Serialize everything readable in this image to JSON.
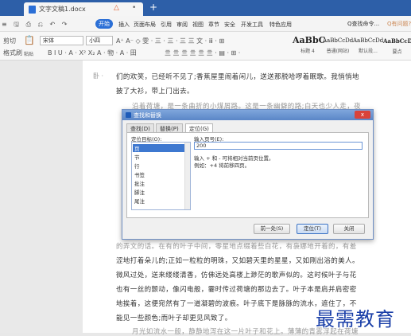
{
  "window": {
    "tab_title": "文字文稿1.docx",
    "tab_warning": "△",
    "tab_close": "•",
    "new_tab": "+"
  },
  "menu": {
    "quick_access": "≡ 🖫 ⎙ ⎌ ↶ ↷",
    "items": [
      "开始",
      "插入",
      "页面布局",
      "引用",
      "审阅",
      "视图",
      "章节",
      "安全",
      "开发工具",
      "特色应用"
    ],
    "active_index": 0,
    "search": "Q查找命令...",
    "help": "Q有问题?"
  },
  "toolbar": {
    "paste": "粘贴",
    "cut": "剪切",
    "format_painter": "格式刷",
    "font": "宋体",
    "size": "小四",
    "format_row": "B I U · A · X² X₂ A · 物 · A · 田",
    "para_row1": "A⁺ A⁻ ◇ 雯 · 三 · 三 · 三 三 文 · ⅲ · ⊞",
    "para_row2": "亖 亖 亖 亖 亖 亖 · ▤ · ⊞ ·",
    "styles": [
      {
        "sample": "AaBbC",
        "caption": "标题 4"
      },
      {
        "sample": "AaBbCcDd",
        "caption": "普通(网站)"
      },
      {
        "sample": "AaBbCcDd",
        "caption": "默认段..."
      },
      {
        "sample": "AaBbCcDc",
        "caption": "要点"
      }
    ]
  },
  "document": {
    "para_marker": "卧 ·",
    "lines": [
      "们的欢笑，已经听不见了;香蕉屋里闹着闲儿，送送那脱哈啰着眠歌。我悄悄地",
      "披了大衫，带上门出去。",
      "沿着荷塘，是一条曲折的小煤屑路。这是一条幽僻的路;白天也少人走，夜",
      "的弄文的话。在有的叶子中间，零星地点缀着些白花，有袅娜地开着的，有羞",
      "涩地打着朵儿的;正如一粒粒的明珠，又如碧天里的星星，又如刚出浴的美人。",
      "微风过处，送来缕缕清香，仿佛远处高楼上渺茫的歌声似的。这时候叶子与花",
      "也有一丝的颤动，像闪电般，霎时传过荷塘的那边去了。叶子本是肩并肩密密",
      "地挨着，这便宛然有了一道凝碧的波痕。叶子底下是脉脉的流水，遮住了，不",
      "能见一些颜色;而叶子却更见风致了。",
      "月光如流水一般，静静地泻在这一片叶子和花上。薄薄的青雾浮起在荷塘"
    ]
  },
  "dialog": {
    "title": "查找和替换",
    "close": "x",
    "tabs": [
      "查找(D)",
      "替换(P)",
      "定位(G)"
    ],
    "active_tab": 2,
    "target_label": "定位目标(O):",
    "targets": [
      "页",
      "节",
      "行",
      "书签",
      "批注",
      "脚注",
      "尾注"
    ],
    "selected_target": 0,
    "page_label": "输入页号(E):",
    "page_value": "200",
    "hint1": "输入 + 和 - 可将相对当前页位置。",
    "hint2": "例如：+4 将前移四页。",
    "btn_prev": "前一处(S)",
    "btn_goto": "定位(T)",
    "btn_close": "关闭"
  },
  "watermark": "最需教育"
}
